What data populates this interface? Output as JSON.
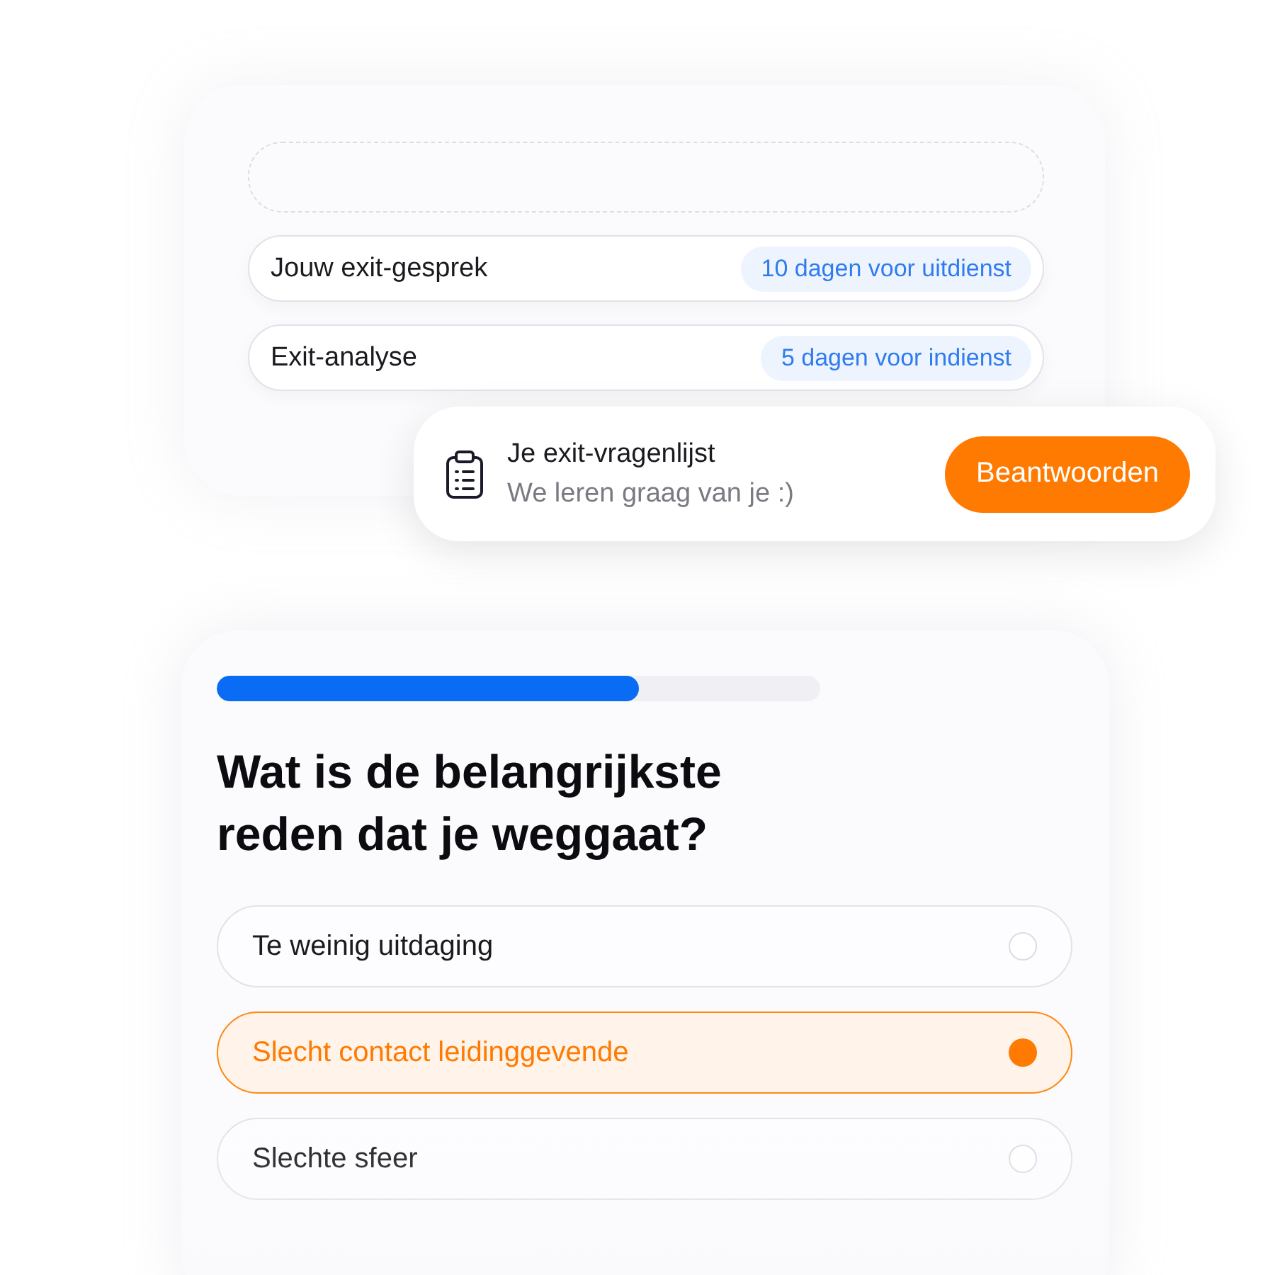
{
  "timeline": {
    "items": [
      {
        "label": "Jouw exit-gesprek",
        "badge": "10 dagen voor uitdienst"
      },
      {
        "label": "Exit-analyse",
        "badge": "5 dagen voor indienst"
      }
    ]
  },
  "notification": {
    "title": "Je exit-vragenlijst",
    "subtitle": "We leren graag van je :)",
    "button": "Beantwoorden"
  },
  "survey": {
    "progress": {
      "level": 0.7
    },
    "question": "Wat is de belangrijkste reden dat je weggaat?",
    "options": [
      {
        "label": "Te weinig uitdaging",
        "selected": false
      },
      {
        "label": "Slecht contact leidinggevende",
        "selected": true
      },
      {
        "label": "Slechte sfeer",
        "selected": false
      }
    ]
  }
}
